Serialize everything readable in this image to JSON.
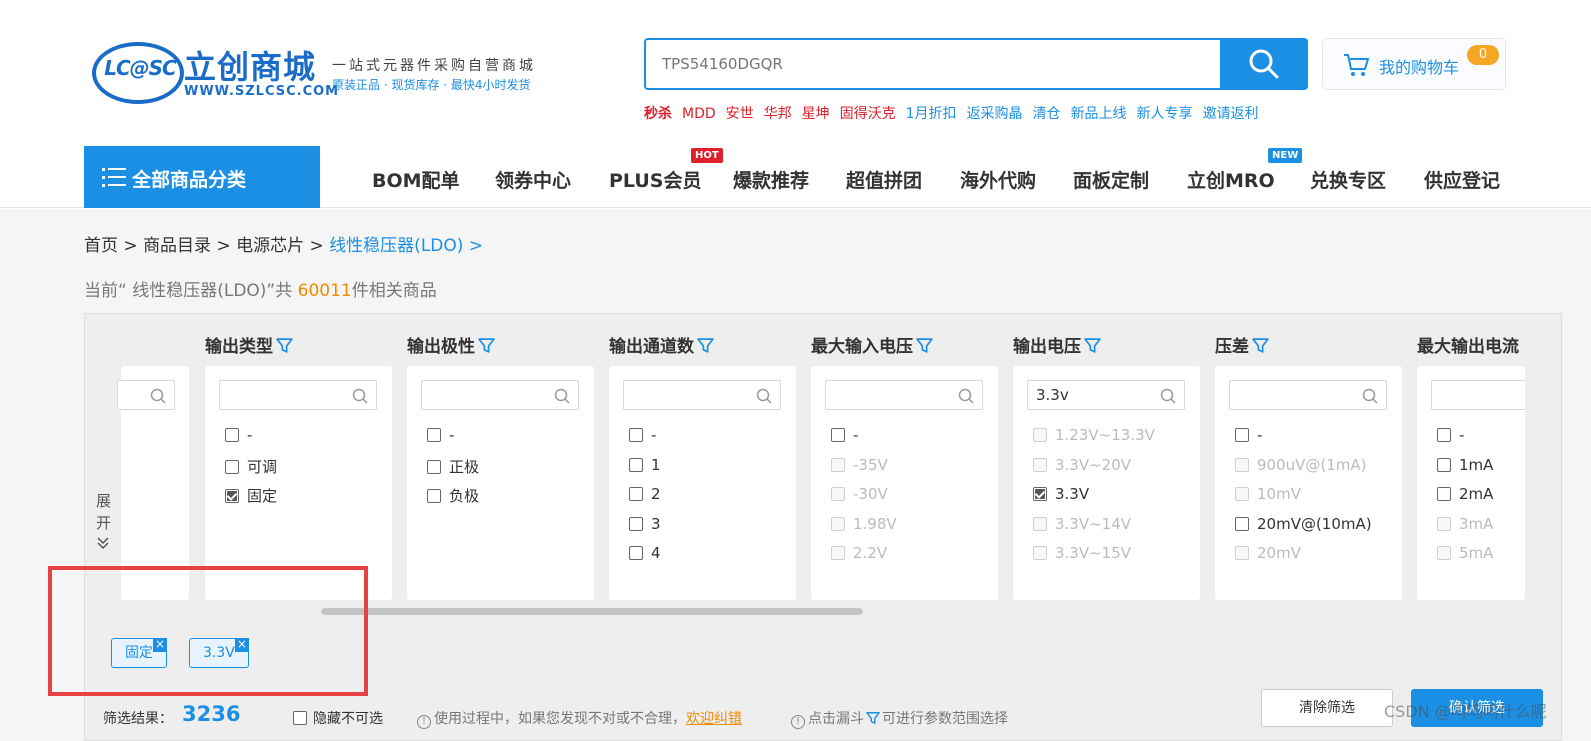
{
  "logo": {
    "mark": "LC@SC",
    "name": "立创商城",
    "url": "WWW.SZLCSC.COM",
    "slogan1": "一站式元器件采购自营商城",
    "slogan2": "原装正品 · 现货库存 · 最快4小时发货"
  },
  "search": {
    "placeholder": "TPS54160DGQR"
  },
  "cart": {
    "label": "我的购物车",
    "count": "0"
  },
  "hot_links": [
    "秒杀",
    "MDD",
    "安世",
    "华邦",
    "星坤",
    "固得沃克",
    "1月折扣",
    "返采购晶",
    "清仓",
    "新品上线",
    "新人专享",
    "邀请返利"
  ],
  "nav": {
    "all_label": "全部商品分类",
    "items": [
      "BOM配单",
      "领券中心",
      "PLUS会员",
      "爆款推荐",
      "超值拼团",
      "海外代购",
      "面板定制",
      "立创MRO",
      "兑换专区",
      "供应登记"
    ],
    "hot_badge": "HOT",
    "new_badge": "NEW"
  },
  "breadcrumb": {
    "home": "首页",
    "catalog": "商品目录",
    "category": "电源芯片",
    "current": "线性稳压器(LDO)",
    "sep": ">"
  },
  "summary": {
    "prefix": "当前“ 线性稳压器(LDO)”共 ",
    "count": "60011",
    "suffix": "件相关商品"
  },
  "filter": {
    "expand": "展开",
    "columns": [
      {
        "title": "输出类型",
        "search": "",
        "options": [
          {
            "label": "-",
            "checked": false,
            "disabled": false
          },
          {
            "label": "可调",
            "checked": false,
            "disabled": false
          },
          {
            "label": "固定",
            "checked": true,
            "disabled": false
          }
        ]
      },
      {
        "title": "输出极性",
        "search": "",
        "options": [
          {
            "label": "-",
            "checked": false,
            "disabled": false
          },
          {
            "label": "正极",
            "checked": false,
            "disabled": false
          },
          {
            "label": "负极",
            "checked": false,
            "disabled": false
          }
        ]
      },
      {
        "title": "输出通道数",
        "search": "",
        "options": [
          {
            "label": "-",
            "checked": false,
            "disabled": false
          },
          {
            "label": "1",
            "checked": false,
            "disabled": false
          },
          {
            "label": "2",
            "checked": false,
            "disabled": false
          },
          {
            "label": "3",
            "checked": false,
            "disabled": false
          },
          {
            "label": "4",
            "checked": false,
            "disabled": false
          }
        ]
      },
      {
        "title": "最大输入电压",
        "search": "",
        "options": [
          {
            "label": "-",
            "checked": false,
            "disabled": false
          },
          {
            "label": "-35V",
            "checked": false,
            "disabled": true
          },
          {
            "label": "-30V",
            "checked": false,
            "disabled": true
          },
          {
            "label": "1.98V",
            "checked": false,
            "disabled": true
          },
          {
            "label": "2.2V",
            "checked": false,
            "disabled": true
          }
        ]
      },
      {
        "title": "输出电压",
        "search": "3.3v",
        "options": [
          {
            "label": "1.23V~13.3V",
            "checked": false,
            "disabled": true
          },
          {
            "label": "3.3V~20V",
            "checked": false,
            "disabled": true
          },
          {
            "label": "3.3V",
            "checked": true,
            "disabled": false
          },
          {
            "label": "3.3V~14V",
            "checked": false,
            "disabled": true
          },
          {
            "label": "3.3V~15V",
            "checked": false,
            "disabled": true
          }
        ]
      },
      {
        "title": "压差",
        "search": "",
        "options": [
          {
            "label": "-",
            "checked": false,
            "disabled": false
          },
          {
            "label": "900uV@(1mA)",
            "checked": false,
            "disabled": true
          },
          {
            "label": "10mV",
            "checked": false,
            "disabled": true
          },
          {
            "label": "20mV@(10mA)",
            "checked": false,
            "disabled": false
          },
          {
            "label": "20mV",
            "checked": false,
            "disabled": true
          }
        ]
      },
      {
        "title": "最大输出电流",
        "search": "",
        "options": [
          {
            "label": "-",
            "checked": false,
            "disabled": false
          },
          {
            "label": "1mA",
            "checked": false,
            "disabled": false
          },
          {
            "label": "2mA",
            "checked": false,
            "disabled": false
          },
          {
            "label": "3mA",
            "checked": false,
            "disabled": true
          },
          {
            "label": "5mA",
            "checked": false,
            "disabled": true
          }
        ]
      }
    ],
    "selected_tags": [
      "固定",
      "3.3V"
    ],
    "result_label": "筛选结果：",
    "result_count": "3236",
    "hide_unselectable": "隐藏不可选",
    "tip1_prefix": "使用过程中，如果您发现不对或不合理，",
    "tip1_link": "欢迎纠错",
    "tip2_prefix": "点击漏斗",
    "tip2_suffix": "可进行参数范围选择",
    "clear_label": "清除筛选",
    "confirm_label": "确认筛选"
  },
  "watermark": "CSDN @呜呜呜什么呢",
  "colors": {
    "brand_blue": "#1a8fe3",
    "hot_red": "#e0202a",
    "highlight_red": "#e84141",
    "accent_orange": "#f08a00"
  }
}
